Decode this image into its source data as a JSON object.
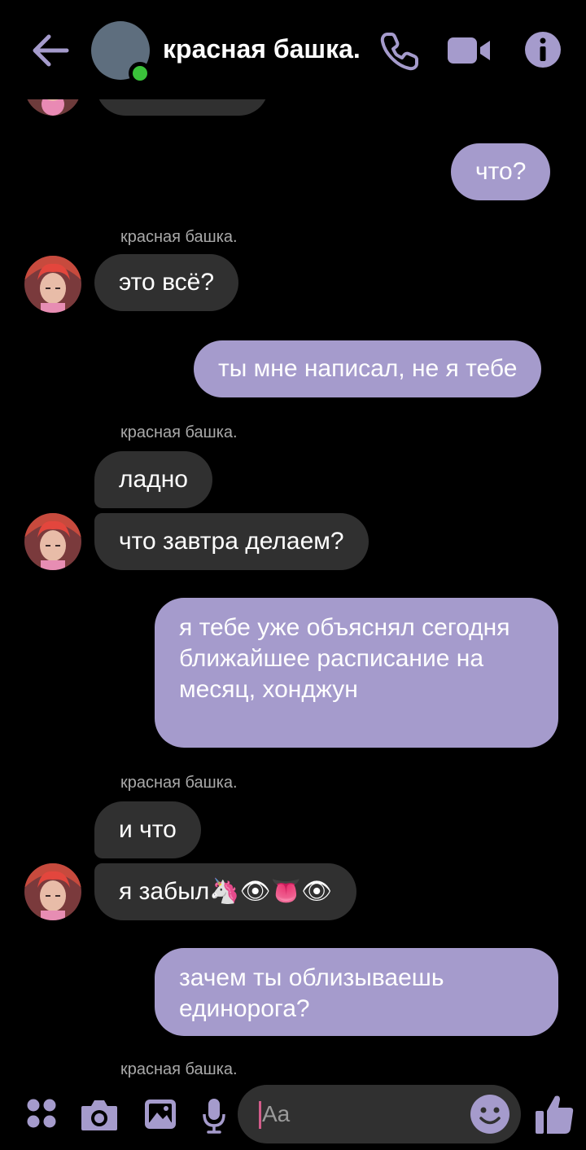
{
  "header": {
    "title": "красная башка.",
    "status": "online",
    "accent": "#a59bcc"
  },
  "messages": {
    "m1": "что?",
    "s1": "красная башка.",
    "m2": "это всё?",
    "m3": "ты мне написал, не я тебе",
    "s2": "красная башка.",
    "m4": "ладно",
    "m5": "что завтра делаем?",
    "m6": "я тебе уже объяснял сегодня ближайшее расписание на месяц, хонджун",
    "s3": "красная башка.",
    "m7": "и что",
    "m8": "я забыл🦄👁👅👁",
    "m9": "зачем ты облизываешь единорога?",
    "s4": "красная башка."
  },
  "composer": {
    "placeholder": "Aa"
  },
  "colors": {
    "incoming_bubble": "#303030",
    "outgoing_bubble": "#a59bcc",
    "background": "#000000",
    "online": "#3ac23a"
  }
}
